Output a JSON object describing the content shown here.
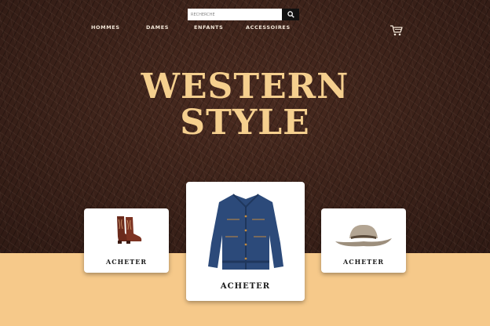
{
  "search": {
    "placeholder": "RECHERCHE",
    "value": ""
  },
  "nav": {
    "items": [
      "HOMMES",
      "DAMES",
      "ENFANTS",
      "ACCESSOIRES"
    ]
  },
  "icons": {
    "search": "search-icon",
    "cart": "cart-icon"
  },
  "hero": {
    "line1": "WESTERN",
    "line2": "STYLE"
  },
  "products": [
    {
      "image": "boots",
      "label": "ACHETER"
    },
    {
      "image": "denim-jacket",
      "label": "ACHETER"
    },
    {
      "image": "cowboy-hat",
      "label": "ACHETER"
    }
  ],
  "colors": {
    "title": "#f5cf8e",
    "sand": "#f6c98a",
    "leather": "#3a2119"
  }
}
